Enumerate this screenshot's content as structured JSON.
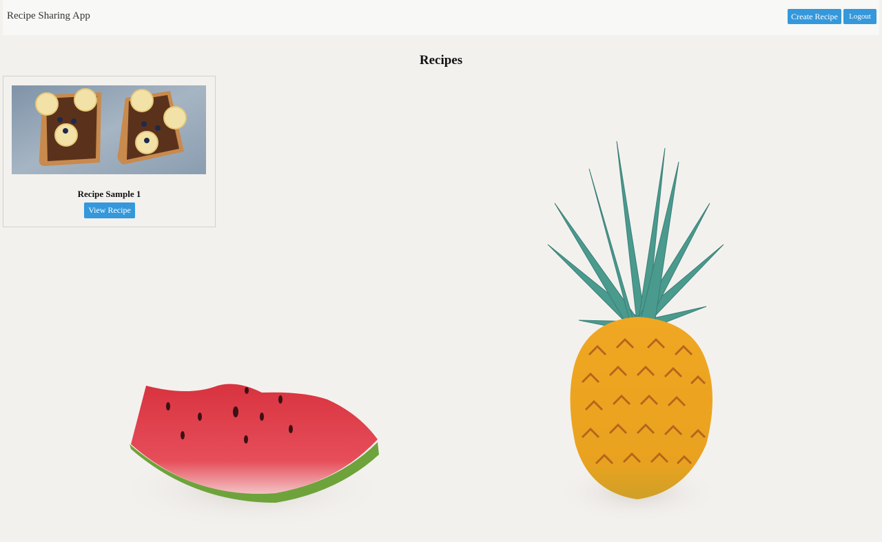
{
  "navbar": {
    "brand": "Recipe Sharing App",
    "create_label": "Create Recipe",
    "logout_label": "Logout"
  },
  "page": {
    "title": "Recipes"
  },
  "recipes": [
    {
      "title": "Recipe Sample 1",
      "button_label": "View Recipe",
      "image_icon": "banana-toast-image"
    }
  ],
  "decor": {
    "left": "watermelon-illustration",
    "right": "pineapple-illustration"
  },
  "colors": {
    "accent": "#3498db",
    "background": "#f3f1ee",
    "navbar": "#f8f8f7"
  }
}
